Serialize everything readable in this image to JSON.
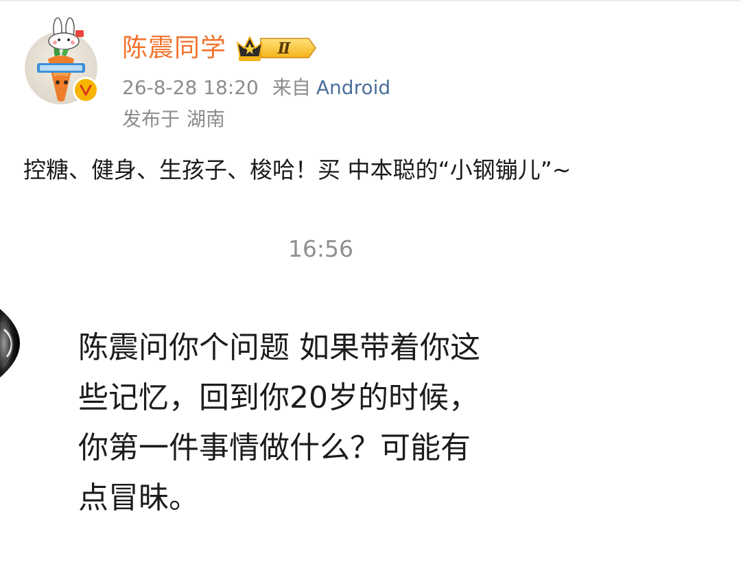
{
  "post": {
    "username": "陈震同学",
    "rank_badge": "Ⅱ",
    "timestamp": "26-8-28 18:20",
    "source_prefix": "来自",
    "source": "Android",
    "location_prefix": "发布于",
    "location": "湖南",
    "text": "控糖、健身、生孩子、梭哈！买 中本聪的“小钢镚儿”~"
  },
  "video": {
    "time": "16:56",
    "caption_lines": [
      "陈震问你个问题 如果带着你这",
      "些记忆，回到你20岁的时候，",
      "你第一件事情做什么？可能有",
      "点冒昧。"
    ]
  },
  "icons": {
    "avatar": "carrot-avatar",
    "verified": "verified-v-icon",
    "crown": "crown-icon"
  },
  "colors": {
    "username": "#f1732c",
    "source_link": "#4a6f9a",
    "meta": "#8c8c8c",
    "verified_badge": "#f7b500"
  }
}
